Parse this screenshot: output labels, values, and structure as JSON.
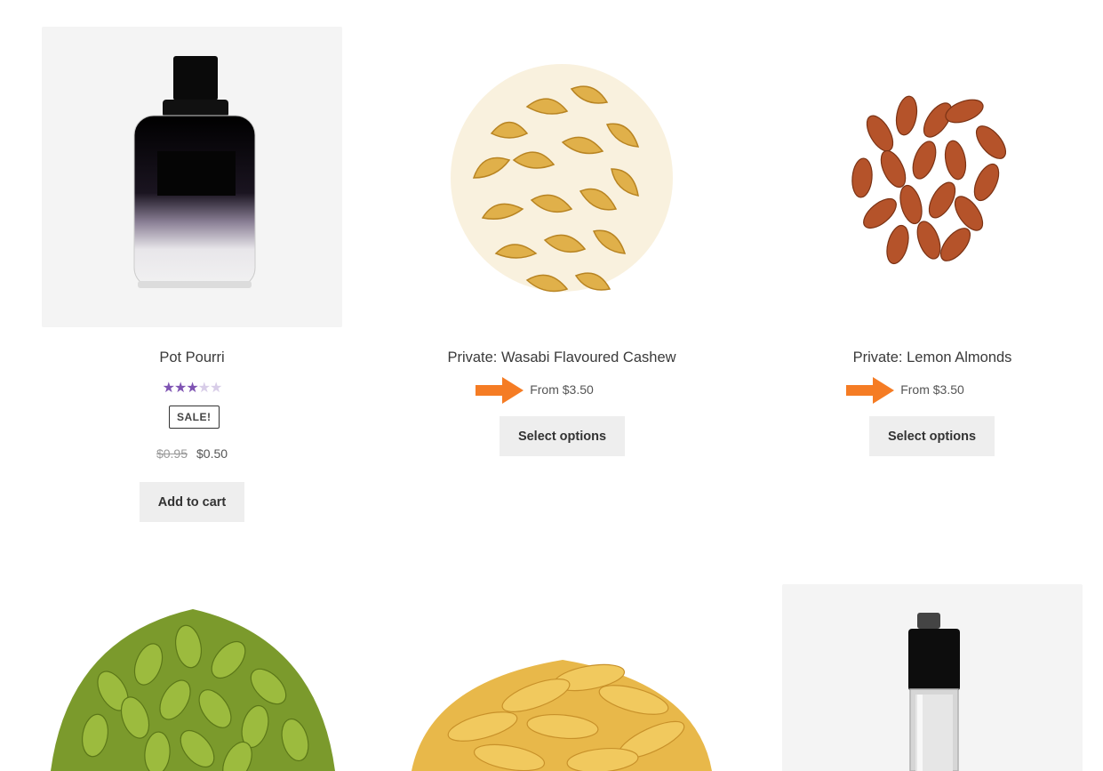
{
  "products": [
    {
      "name": "Pot Pourri",
      "rating": 3,
      "rating_max": 5,
      "sale_badge": "SALE!",
      "old_price": "$0.95",
      "price": "$0.50",
      "button": "Add to cart",
      "image": "perfume-bottle-black"
    },
    {
      "name": "Private: Wasabi Flavoured Cashew",
      "price": "From $3.50",
      "button": "Select options",
      "image": "cashews"
    },
    {
      "name": "Private: Lemon Almonds",
      "price": "From $3.50",
      "button": "Select options",
      "image": "almonds"
    },
    {
      "image": "pumpkin-seeds"
    },
    {
      "image": "banana-chips"
    },
    {
      "image": "perfume-bottle-clear"
    }
  ],
  "colors": {
    "rating_star": "#7f54b3",
    "annotation_arrow": "#f57c24",
    "button_bg": "#eeeeee"
  }
}
